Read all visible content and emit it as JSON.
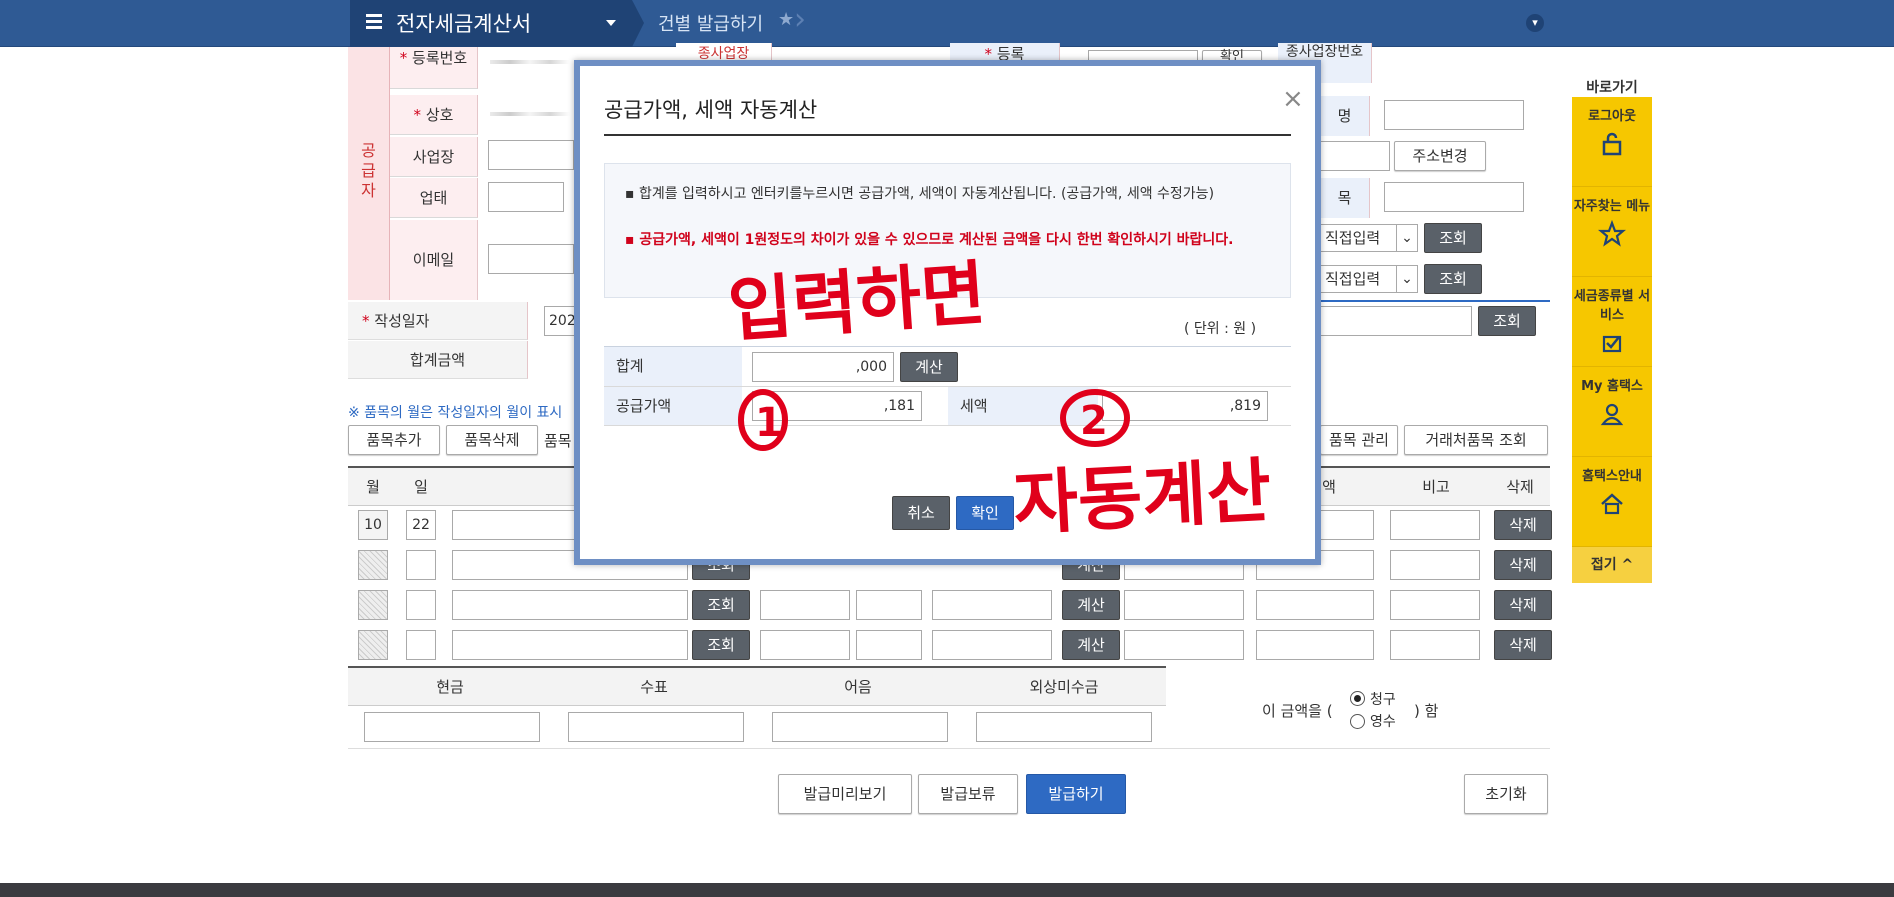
{
  "header": {
    "app_title": "전자세금계산서",
    "breadcrumb": "건별 발급하기"
  },
  "supplier": {
    "section_label": "공급자",
    "reg_label": "등록번호",
    "name_label": "상호",
    "addr_label": "사업장",
    "biztype_label": "업태",
    "email_label": "이메일",
    "branch_label": "종사업장"
  },
  "buyer": {
    "reg_label": "등록",
    "check_btn": "확인",
    "branch_label": "종사업장번호",
    "name_label": "명",
    "addr_change_btn": "주소변경",
    "item_label": "목",
    "direct_input_1": "직접입력",
    "direct_input_2": "직접입력",
    "lookup_btn": "조회"
  },
  "form": {
    "write_date_label": "작성일자",
    "write_date_value": "202",
    "total_amount_label": "합계금액",
    "note_text": "※ 품목의 월은 작성일자의 월이 표시",
    "add_item_btn": "품목추가",
    "delete_item_btn": "품목삭제",
    "item_label_partial": "품목",
    "manage_item_btn": "품목 관리",
    "partner_item_btn": "거래처품목 조회",
    "lookup_btn": "조회",
    "calc_btn": "계산"
  },
  "table": {
    "headers": [
      "월",
      "일",
      "액",
      "비고",
      "삭제"
    ],
    "rows": [
      {
        "month": "10",
        "day": "22",
        "delete": "삭제"
      },
      {
        "month": "",
        "day": "",
        "delete": "삭제"
      },
      {
        "month": "",
        "day": "",
        "delete": "삭제"
      },
      {
        "month": "",
        "day": "",
        "delete": "삭제"
      }
    ]
  },
  "payment": {
    "headers": [
      "현금",
      "수표",
      "어음",
      "외상미수금"
    ],
    "amount_prefix": "이 금액을 (",
    "amount_suffix": ") 함",
    "option_claim": "청구",
    "option_receipt": "영수"
  },
  "actions": {
    "preview": "발급미리보기",
    "hold": "발급보류",
    "issue": "발급하기",
    "reset": "초기화"
  },
  "sidebar": {
    "title": "바로가기",
    "items": [
      {
        "label": "로그아웃",
        "icon": "lock-icon"
      },
      {
        "label": "자주찾는 메뉴",
        "icon": "star-icon"
      },
      {
        "label": "세금종류별 서비스",
        "icon": "checkbox-icon"
      },
      {
        "label": "My 홈택스",
        "icon": "user-icon"
      },
      {
        "label": "홈택스안내",
        "icon": "home-icon"
      }
    ],
    "collapse": "접기 ^"
  },
  "dialog": {
    "title": "공급가액, 세액 자동계산",
    "close": "×",
    "note1": "합계를 입력하시고 엔터키를누르시면 공급가액, 세액이 자동계산됩니다. (공급가액, 세액 수정가능)",
    "note2": "공급가액, 세액이 1원정도의 차이가 있을 수 있으므로 계산된 금액을 다시 한번 확인하시기 바랍니다.",
    "unit": "( 단위 : 원 )",
    "total_label": "합계",
    "total_value": ",000",
    "calc_btn": "계산",
    "supply_label": "공급가액",
    "supply_value": ",181",
    "tax_label": "세액",
    "tax_value": ",819",
    "cancel_btn": "취소",
    "ok_btn": "확인"
  },
  "annotations": {
    "text1": "입력하면",
    "num1": "1",
    "num2": "2",
    "text2": "자동계산"
  },
  "colors": {
    "topbar": "#2f5a94",
    "topbar_dark": "#1f4375",
    "accent_blue": "#2e6ac3",
    "sidebar_yellow": "#f6c700",
    "handwriting_red": "#e0001b",
    "dialog_border": "#6e8fc4"
  }
}
